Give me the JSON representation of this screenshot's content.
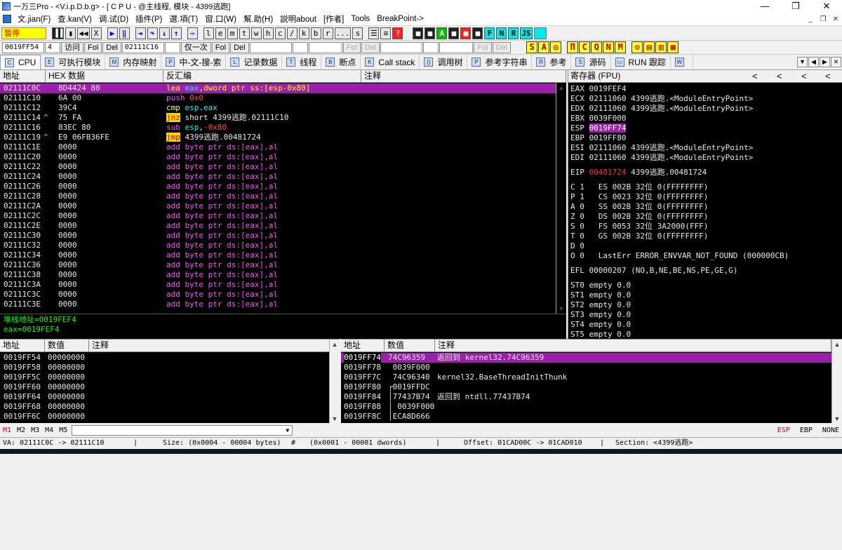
{
  "window": {
    "title": "一万三Pro - <V.i.p.D.b.g> - [ C P U  - @主线程, 模块 - 4399逃跑]",
    "min": "—",
    "max": "❐",
    "close": "✕"
  },
  "menu": [
    "文.jian(F)",
    "查.kan(V)",
    "调.试(D)",
    "插件(P)",
    "選.項(T)",
    "窗.口(W)",
    "幫.助(H)",
    "説明about",
    "[作者]",
    "Tools",
    "BreakPoint->"
  ],
  "mdi": [
    "_",
    "❐",
    "✕"
  ],
  "toolbar1": {
    "status": "暂停",
    "buttons": [
      "▐▐",
      "▮",
      "◀◀",
      "X",
      "▶",
      "‖",
      "⇥",
      "↷",
      "↓",
      "↑",
      "⇨",
      "l",
      "e",
      "m",
      "t",
      "w",
      "h",
      "c",
      "/",
      "k",
      "b",
      "r",
      "...",
      "s",
      "☰",
      "≡",
      "?"
    ],
    "colored": [
      "■",
      "■",
      "A",
      "■",
      "■",
      "■",
      "F",
      "N",
      "R",
      "JS"
    ]
  },
  "toolbar2": {
    "addr": "0019FF54",
    "count": "4",
    "visit": "访问",
    "fol1": "Fol",
    "del1": "Del",
    "addr2": "02111C16",
    "once": "仅一次",
    "fol2": "Fol",
    "del2": "Del",
    "fol3": "Fol",
    "del3": "Del",
    "fol4": "Fol",
    "del4": "Del",
    "yellow": [
      "S",
      "A",
      "◎",
      "Π",
      "C",
      "Q",
      "N",
      "M",
      "⚙",
      "▤",
      "▥",
      "▦"
    ]
  },
  "tabs": [
    {
      "icon": "C",
      "label": "CPU"
    },
    {
      "icon": "E",
      "label": "可执行模块"
    },
    {
      "icon": "M",
      "label": "内存映射"
    },
    {
      "icon": "P",
      "label": "中-文-搜-索"
    },
    {
      "icon": "L",
      "label": "记录数据"
    },
    {
      "icon": "T",
      "label": "线程"
    },
    {
      "icon": "B",
      "label": "断点"
    },
    {
      "icon": "K",
      "label": "Call stack"
    },
    {
      "icon": "()",
      "label": "调用树"
    },
    {
      "icon": "P",
      "label": "参考字符串"
    },
    {
      "icon": "R",
      "label": "参考"
    },
    {
      "icon": "S",
      "label": "源码"
    },
    {
      "icon": "▭",
      "label": "RUN 跟踪"
    },
    {
      "icon": "W",
      "label": ""
    }
  ],
  "disasm": {
    "headers": {
      "addr": "地址",
      "hex": "HEX 数据",
      "asm": "反汇编",
      "comment": "注释"
    },
    "rows": [
      {
        "addr": "02111C0C",
        "mark": "",
        "hex": "8D4424 80",
        "asm": [
          [
            "op",
            "lea "
          ],
          [
            "x",
            "eax"
          ],
          [
            "op",
            ",dword ptr ss:[esp-0x80]"
          ]
        ],
        "sel": true
      },
      {
        "addr": "02111C10",
        "mark": "",
        "hex": "6A 00",
        "asm": [
          [
            "push",
            "push "
          ],
          [
            "neg",
            "0x0"
          ]
        ]
      },
      {
        "addr": "02111C12",
        "mark": "",
        "hex": "39C4",
        "asm": [
          [
            "cmp",
            "cmp "
          ],
          [
            "x",
            "esp"
          ],
          [
            "",
            "."
          ],
          [
            "x",
            "eax"
          ]
        ]
      },
      {
        "addr": "02111C14",
        "mark": "^",
        "hex": "75 FA",
        "asm": [
          [
            "jmp",
            "jnz"
          ],
          [
            "",
            " short 4399逃跑.02111C10"
          ]
        ]
      },
      {
        "addr": "02111C16",
        "mark": "",
        "hex": "83EC 80",
        "asm": [
          [
            "sub",
            "sub "
          ],
          [
            "x",
            "esp"
          ],
          [
            "",
            ","
          ],
          [
            "neg",
            "-0x80"
          ]
        ]
      },
      {
        "addr": "02111C19",
        "mark": "^",
        "hex": "E9 06FB36FE",
        "asm": [
          [
            "jmp",
            "jmp"
          ],
          [
            "",
            " 4399逃跑.00481724"
          ]
        ]
      },
      {
        "addr": "02111C1E",
        "mark": "",
        "hex": "0000",
        "asm": [
          [
            "add",
            "add byte ptr ds:[eax],al"
          ]
        ]
      },
      {
        "addr": "02111C20",
        "mark": "",
        "hex": "0000",
        "asm": [
          [
            "add",
            "add byte ptr ds:[eax],al"
          ]
        ]
      },
      {
        "addr": "02111C22",
        "mark": "",
        "hex": "0000",
        "asm": [
          [
            "add",
            "add byte ptr ds:[eax],al"
          ]
        ]
      },
      {
        "addr": "02111C24",
        "mark": "",
        "hex": "0000",
        "asm": [
          [
            "add",
            "add byte ptr ds:[eax],al"
          ]
        ]
      },
      {
        "addr": "02111C26",
        "mark": "",
        "hex": "0000",
        "asm": [
          [
            "add",
            "add byte ptr ds:[eax],al"
          ]
        ]
      },
      {
        "addr": "02111C28",
        "mark": "",
        "hex": "0000",
        "asm": [
          [
            "add",
            "add byte ptr ds:[eax],al"
          ]
        ]
      },
      {
        "addr": "02111C2A",
        "mark": "",
        "hex": "0000",
        "asm": [
          [
            "add",
            "add byte ptr ds:[eax],al"
          ]
        ]
      },
      {
        "addr": "02111C2C",
        "mark": "",
        "hex": "0000",
        "asm": [
          [
            "add",
            "add byte ptr ds:[eax],al"
          ]
        ]
      },
      {
        "addr": "02111C2E",
        "mark": "",
        "hex": "0000",
        "asm": [
          [
            "add",
            "add byte ptr ds:[eax],al"
          ]
        ]
      },
      {
        "addr": "02111C30",
        "mark": "",
        "hex": "0000",
        "asm": [
          [
            "add",
            "add byte ptr ds:[eax],al"
          ]
        ]
      },
      {
        "addr": "02111C32",
        "mark": "",
        "hex": "0000",
        "asm": [
          [
            "add",
            "add byte ptr ds:[eax],al"
          ]
        ]
      },
      {
        "addr": "02111C34",
        "mark": "",
        "hex": "0000",
        "asm": [
          [
            "add",
            "add byte ptr ds:[eax],al"
          ]
        ]
      },
      {
        "addr": "02111C36",
        "mark": "",
        "hex": "0000",
        "asm": [
          [
            "add",
            "add byte ptr ds:[eax],al"
          ]
        ]
      },
      {
        "addr": "02111C38",
        "mark": "",
        "hex": "0000",
        "asm": [
          [
            "add",
            "add byte ptr ds:[eax],al"
          ]
        ]
      },
      {
        "addr": "02111C3A",
        "mark": "",
        "hex": "0000",
        "asm": [
          [
            "add",
            "add byte ptr ds:[eax],al"
          ]
        ]
      },
      {
        "addr": "02111C3C",
        "mark": "",
        "hex": "0000",
        "asm": [
          [
            "add",
            "add byte ptr ds:[eax],al"
          ]
        ]
      },
      {
        "addr": "02111C3E",
        "mark": "",
        "hex": "0000",
        "asm": [
          [
            "add",
            "add byte ptr ds:[eax],al"
          ]
        ]
      }
    ]
  },
  "info": [
    "堆栈地址=0019FEF4",
    "eax=0019FEF4"
  ],
  "registers": {
    "header": "寄存器 (FPU)",
    "arrows": [
      "<",
      "<",
      "<",
      "<"
    ],
    "lines": [
      {
        "t": "EAX 0019FEF4"
      },
      {
        "t": "ECX 02111060 4399逃跑.<ModuleEntryPoint>"
      },
      {
        "t": "EDX 02111060 4399逃跑.<ModuleEntryPoint>"
      },
      {
        "t": "EBX 0039F000"
      },
      {
        "t": "ESP ",
        "hl": "0019FF74"
      },
      {
        "t": "EBP 0019FF80"
      },
      {
        "t": "ESI 02111060 4399逃跑.<ModuleEntryPoint>"
      },
      {
        "t": "EDI 02111060 4399逃跑.<ModuleEntryPoint>"
      },
      {
        "t": "EIP ",
        "red": "00481724",
        "rest": " 4399逃跑.00481724",
        "gap": true
      },
      {
        "t": "C 1   ES 002B 32位 0(FFFFFFFF)",
        "gap": true
      },
      {
        "t": "P 1   CS 0023 32位 0(FFFFFFFF)"
      },
      {
        "t": "A 0   SS 002B 32位 0(FFFFFFFF)"
      },
      {
        "t": "Z 0   DS 002B 32位 0(FFFFFFFF)"
      },
      {
        "t": "S 0   FS 0053 32位 3A2000(FFF)"
      },
      {
        "t": "T 0   GS 002B 32位 0(FFFFFFFF)"
      },
      {
        "t": "D 0"
      },
      {
        "t": "O 0   LastErr ERROR_ENVVAR_NOT_FOUND (000000CB)"
      },
      {
        "t": "EFL 00000207 (NO,B,NE,BE,NS,PE,GE,G)",
        "gap": true
      },
      {
        "t": "ST0 empty 0.0",
        "gap": true
      },
      {
        "t": "ST1 empty 0.0"
      },
      {
        "t": "ST2 empty 0.0"
      },
      {
        "t": "ST3 empty 0.0"
      },
      {
        "t": "ST4 empty 0.0"
      },
      {
        "t": "ST5 empty 0.0"
      }
    ]
  },
  "dump": {
    "headers": {
      "addr": "地址",
      "val": "数值",
      "comment": "注释"
    },
    "rows": [
      [
        "0019FF54",
        "00000000"
      ],
      [
        "0019FF58",
        "00000000"
      ],
      [
        "0019FF5C",
        "00000000"
      ],
      [
        "0019FF60",
        "00000000"
      ],
      [
        "0019FF64",
        "00000000"
      ],
      [
        "0019FF68",
        "00000000"
      ],
      [
        "0019FF6C",
        "00000000"
      ]
    ]
  },
  "stack": {
    "headers": {
      "addr": "地址",
      "val": "数值",
      "comment": "注释"
    },
    "rows": [
      {
        "addr": "0019FF74",
        "val": "74C96359",
        "comment": "返回到 kernel32.74C96359",
        "sel": true
      },
      {
        "addr": "0019FF78",
        "val": " 0039F000",
        "comment": ""
      },
      {
        "addr": "0019FF7C",
        "val": " 74C96340",
        "comment": "kernel32.BaseThreadInitThunk"
      },
      {
        "addr": "0019FF80",
        "val": "┌0019FFDC",
        "comment": ""
      },
      {
        "addr": "0019FF84",
        "val": "│77437B74",
        "comment": "返回到 ntdll.77437B74"
      },
      {
        "addr": "0019FF88",
        "val": "│ 0039F000",
        "comment": ""
      },
      {
        "addr": "0019FF8C",
        "val": "│ECA8D666",
        "comment": ""
      }
    ]
  },
  "cmdbar": {
    "m": [
      "M1",
      "M2",
      "M3",
      "M4",
      "M5"
    ],
    "right": [
      "ESP",
      "EBP",
      "NONE"
    ],
    "dropdown": "▼"
  },
  "status": {
    "va": "VA: 02111C0C -> 02111C10",
    "size": "Size: (0x0004 - 00004 bytes)",
    "hash": "#",
    "dwords": "(0x0001 - 00001 dwords)",
    "offset": "Offset: 01CAD00C -> 01CAD010",
    "section": "Section: <4399逃跑>",
    "sep": "|"
  },
  "colors": {
    "bg": "#000000",
    "sel": "#9b1fa8",
    "add": "#ff50ff",
    "reg": "#00ffff",
    "info": "#00ff00"
  }
}
